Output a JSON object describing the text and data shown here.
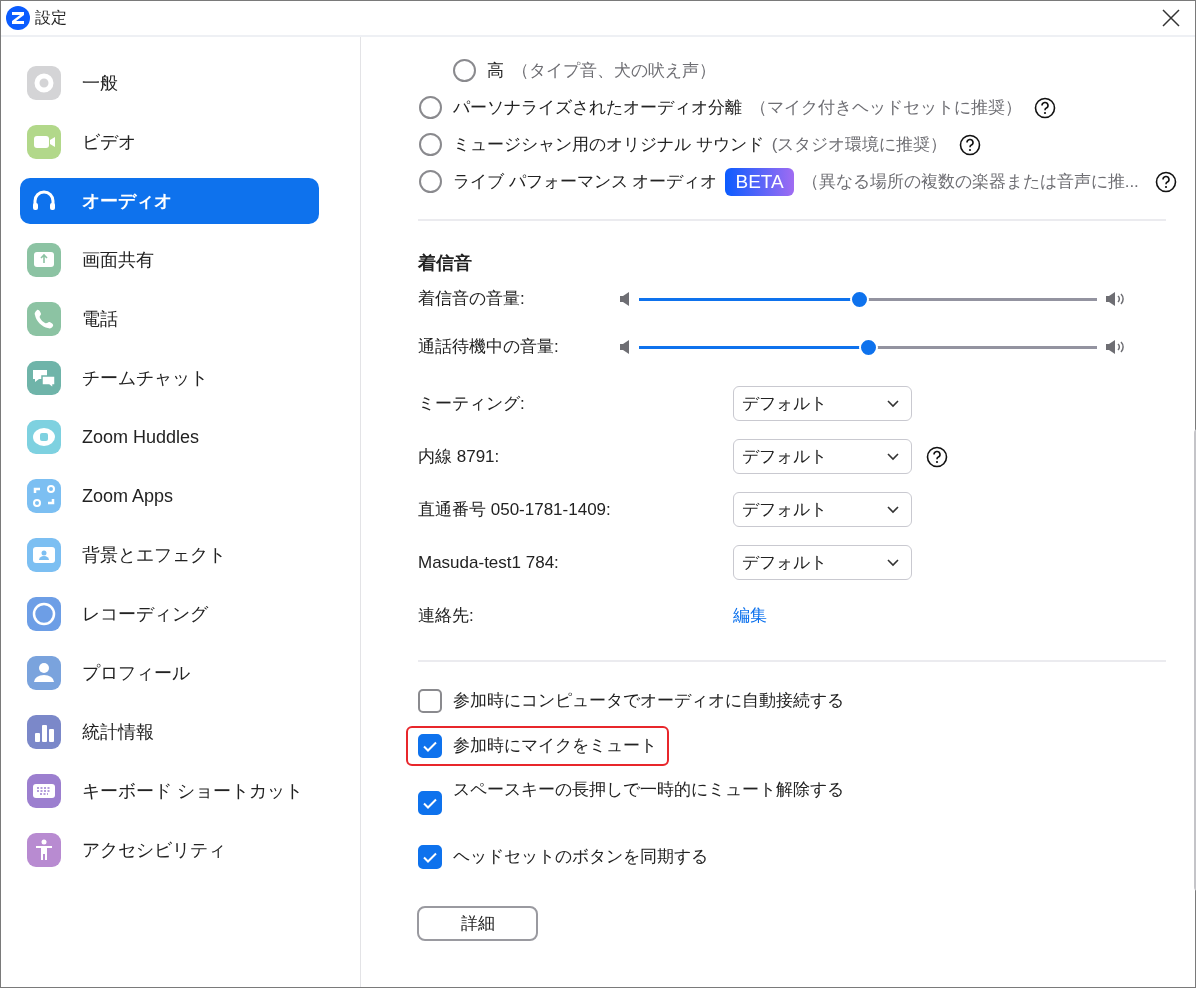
{
  "window": {
    "title": "設定"
  },
  "sidebar": {
    "items": [
      {
        "label": "一般",
        "selected": false
      },
      {
        "label": "ビデオ",
        "selected": false
      },
      {
        "label": "オーディオ",
        "selected": true
      },
      {
        "label": "画面共有",
        "selected": false
      },
      {
        "label": "電話",
        "selected": false
      },
      {
        "label": "チームチャット",
        "selected": false
      },
      {
        "label": "Zoom Huddles",
        "selected": false
      },
      {
        "label": "Zoom Apps",
        "selected": false
      },
      {
        "label": "背景とエフェクト",
        "selected": false
      },
      {
        "label": "レコーディング",
        "selected": false
      },
      {
        "label": "プロフィール",
        "selected": false
      },
      {
        "label": "統計情報",
        "selected": false
      },
      {
        "label": "キーボード ショートカット",
        "selected": false
      },
      {
        "label": "アクセシビリティ",
        "selected": false
      }
    ]
  },
  "suppression_levels": [
    {
      "label": "高",
      "note": "（タイプ音、犬の吠え声）",
      "selected": false
    }
  ],
  "audio_modes": [
    {
      "label": "パーソナライズされたオーディオ分離",
      "note": "（マイク付きヘッドセットに推奨）",
      "selected": false,
      "help": true
    },
    {
      "label": "ミュージシャン用のオリジナル サウンド",
      "note": "(スタジオ環境に推奨）",
      "selected": false,
      "help": true
    },
    {
      "label": "ライブ パフォーマンス オーディオ",
      "badge": "BETA",
      "note": "（異なる場所の複数の楽器または音声に推...",
      "selected": false,
      "help": true
    }
  ],
  "ringtones": {
    "heading": "着信音",
    "volumes": [
      {
        "label": "着信音の音量:",
        "level": 0.48
      },
      {
        "label": "通話待機中の音量:",
        "level": 0.5
      }
    ],
    "selects": [
      {
        "label": "ミーティング:",
        "value": "デフォルト",
        "help": false
      },
      {
        "label": "内線 8791:",
        "value": "デフォルト",
        "help": true
      },
      {
        "label": "直通番号 050-1781-1409:",
        "value": "デフォルト",
        "help": false
      },
      {
        "label": "Masuda-test1 784:",
        "value": "デフォルト",
        "help": false
      }
    ],
    "contacts": {
      "label": "連絡先:",
      "link": "編集"
    }
  },
  "options": [
    {
      "label": "参加時にコンピュータでオーディオに自動接続する",
      "checked": false,
      "highlighted": false
    },
    {
      "label": "参加時にマイクをミュート",
      "checked": true,
      "highlighted": true
    },
    {
      "label": "スペースキーの長押しで一時的にミュート解除する",
      "checked": true,
      "highlighted": false
    },
    {
      "label": "ヘッドセットのボタンを同期する",
      "checked": true,
      "highlighted": false
    }
  ],
  "advanced_button": "詳細"
}
